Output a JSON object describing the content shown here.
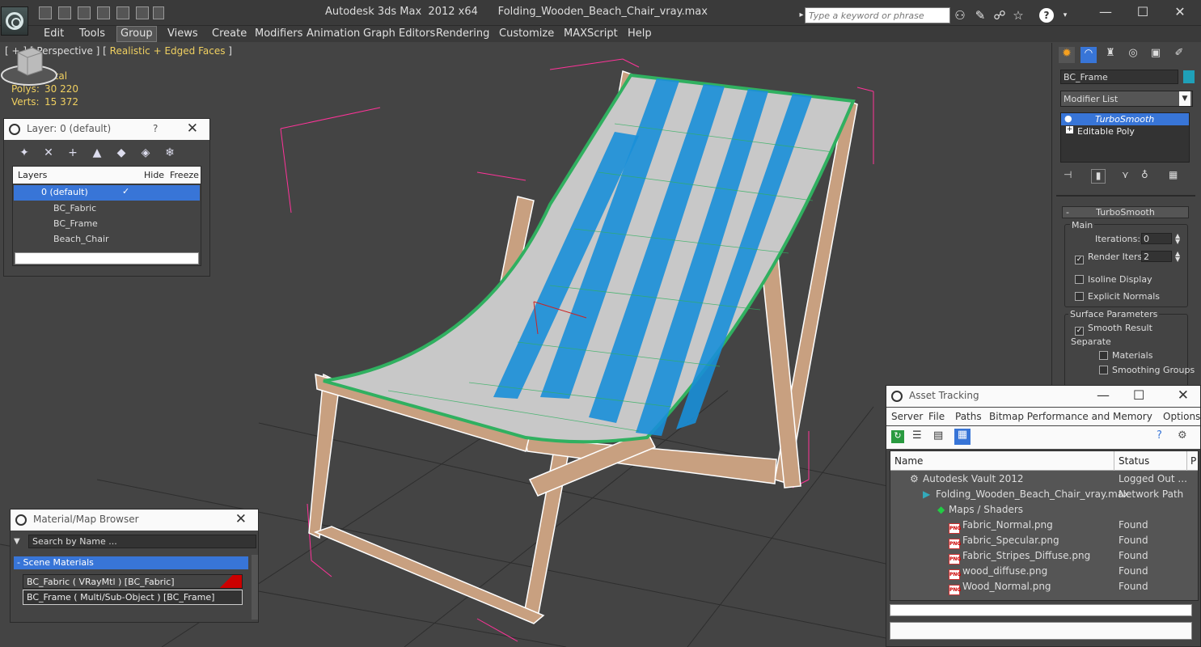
{
  "app": {
    "title": "Autodesk 3ds Max  2012 x64      Folding_Wooden_Beach_Chair_vray.max",
    "search_placeholder": "Type a keyword or phrase",
    "help_label": "?",
    "minimize": "—",
    "maximize": "☐",
    "close": "✕",
    "close_right": "✕"
  },
  "menu": [
    "Edit",
    "Tools",
    "Group",
    "Views",
    "Create",
    "Modifiers",
    "Animation",
    "Graph Editors",
    "Rendering",
    "Customize",
    "MAXScript",
    "Help"
  ],
  "viewport": {
    "label_plain": "[ + ] [ Perspective ] [ ",
    "label_mode": "Realistic + Edged Faces",
    "label_end": " ]",
    "stats_header": "Total",
    "polys_label": "Polys:",
    "polys_value": "30 220",
    "verts_label": "Verts:",
    "verts_value": "15 372",
    "colors": {
      "fabric_blue": "#1a8fd8",
      "fabric_white": "#c8c8c8",
      "wire_green": "#30b060",
      "frame_wood": "#c8a080",
      "selection": "#ff3399"
    }
  },
  "layer_panel": {
    "title": "Layer: 0 (default)",
    "help": "?",
    "close": "✕",
    "col_layers": "Layers",
    "col_hide": "Hide",
    "col_freeze": "Freeze",
    "rows": [
      {
        "name": "0 (default)",
        "checked": "✓"
      },
      {
        "name": "BC_Fabric"
      },
      {
        "name": "BC_Frame"
      },
      {
        "name": "Beach_Chair"
      }
    ]
  },
  "material_panel": {
    "title": "Material/Map Browser",
    "close": "✕",
    "search_placeholder": "Search by Name ...",
    "section": "- Scene Materials",
    "items": [
      "BC_Fabric  ( VRayMtl )  [BC_Fabric]",
      "BC_Frame  ( Multi/Sub-Object )  [BC_Frame]"
    ]
  },
  "command_panel": {
    "object_name": "BC_Frame",
    "object_color": "#1fa0b8",
    "modifier_list": "Modifier List",
    "stack": [
      "TurboSmooth",
      "Editable Poly"
    ],
    "rollout_title": "TurboSmooth",
    "main_label": "Main",
    "iterations_label": "Iterations:",
    "iterations_value": "0",
    "render_iters_label": "Render Iters:",
    "render_iters_value": "2",
    "isoline": "Isoline Display",
    "explicit_normals": "Explicit Normals",
    "surface_params": "Surface Parameters",
    "smooth_result": "Smooth Result",
    "separate": "Separate",
    "materials": "Materials",
    "smoothing_groups": "Smoothing Groups",
    "check": "✓",
    "collapse": "-"
  },
  "asset_panel": {
    "title": "Asset Tracking",
    "minimize": "—",
    "maximize": "☐",
    "close": "✕",
    "menu": [
      "Server",
      "File",
      "Paths",
      "Bitmap Performance and Memory",
      "Options"
    ],
    "col_name": "Name",
    "col_status": "Status",
    "col_extra": "P",
    "rows": [
      {
        "name": "Autodesk Vault 2012",
        "status": "Logged Out ..."
      },
      {
        "name": "Folding_Wooden_Beach_Chair_vray.max",
        "status": "Network Path"
      },
      {
        "name": "Maps / Shaders",
        "status": ""
      },
      {
        "name": "Fabric_Normal.png",
        "status": "Found"
      },
      {
        "name": "Fabric_Specular.png",
        "status": "Found"
      },
      {
        "name": "Fabric_Stripes_Diffuse.png",
        "status": "Found"
      },
      {
        "name": "wood_diffuse.png",
        "status": "Found"
      },
      {
        "name": "Wood_Normal.png",
        "status": "Found"
      }
    ],
    "png_tag": "PNG"
  }
}
